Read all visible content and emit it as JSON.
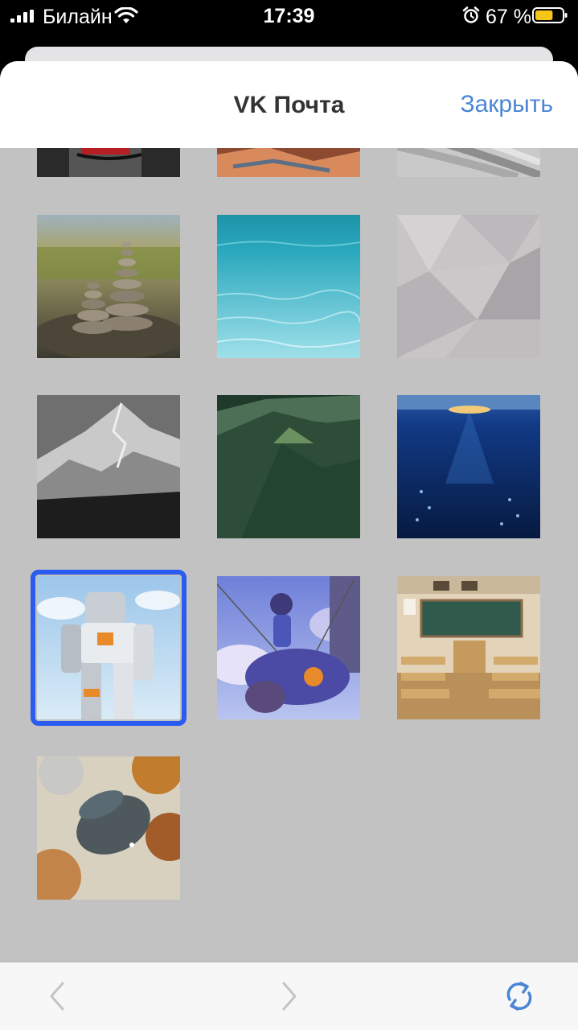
{
  "status_bar": {
    "carrier": "Билайн",
    "time": "17:39",
    "battery_percent": "67 %",
    "battery_level": 0.67,
    "icons": [
      "signal-icon",
      "wifi-icon",
      "alarm-icon",
      "battery-icon"
    ]
  },
  "header": {
    "title": "VK Почта",
    "close_label": "Закрыть"
  },
  "gallery": {
    "selected_index": 9,
    "items": [
      {
        "name": "wallpaper-cartoon-partial"
      },
      {
        "name": "wallpaper-red-rocks-partial"
      },
      {
        "name": "wallpaper-grey-pipes-partial"
      },
      {
        "name": "wallpaper-stone-cairns"
      },
      {
        "name": "wallpaper-underwater-turquoise"
      },
      {
        "name": "wallpaper-grey-polygons"
      },
      {
        "name": "wallpaper-snowy-mountains"
      },
      {
        "name": "wallpaper-green-hills"
      },
      {
        "name": "wallpaper-deep-ocean"
      },
      {
        "name": "wallpaper-robot"
      },
      {
        "name": "wallpaper-anime-girl-scooter"
      },
      {
        "name": "wallpaper-anime-classroom"
      },
      {
        "name": "wallpaper-glass-cups"
      }
    ]
  },
  "toolbar": {
    "back_icon": "chevron-left-icon",
    "forward_icon": "chevron-right-icon",
    "refresh_icon": "refresh-icon"
  },
  "colors": {
    "accent": "#4a86d4",
    "selection": "#2a5cf0",
    "sheet_background": "#c2c2c2"
  }
}
